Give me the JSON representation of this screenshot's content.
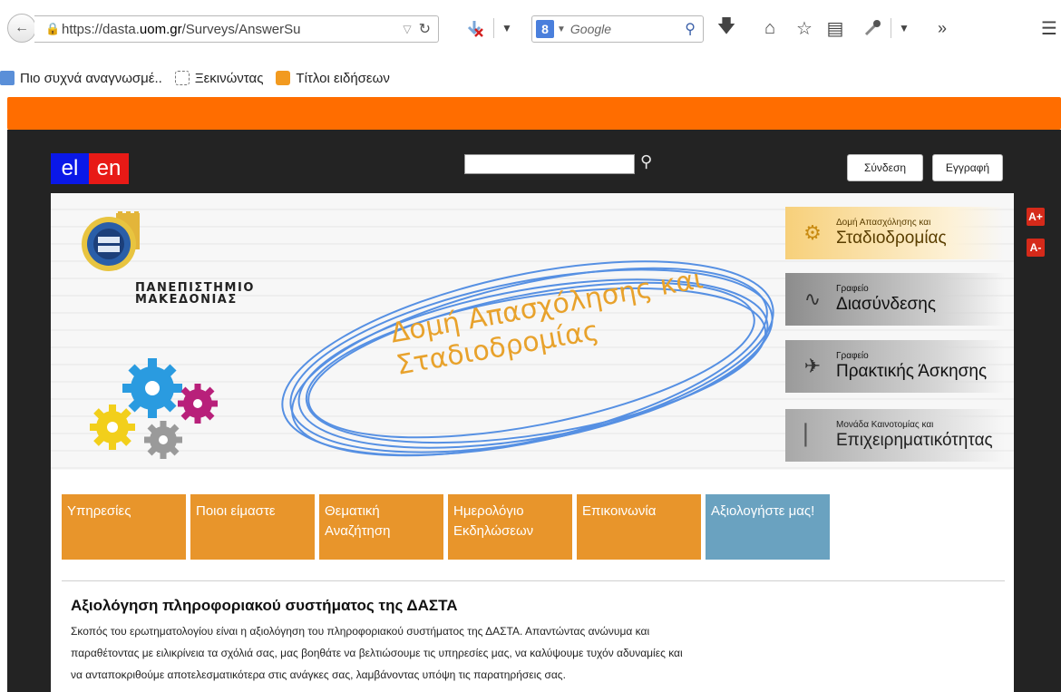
{
  "browser": {
    "url_prefix": "https://dasta.",
    "url_domain": "uom.gr",
    "url_path": "/Surveys/AnswerSu",
    "search_engine_badge": "8",
    "search_placeholder": "Google",
    "bookmarks": [
      {
        "label": "Πιο συχνά αναγνωσμέ..",
        "icon": "bookmark-page-icon"
      },
      {
        "label": "Ξεκινώντας",
        "icon": "dashed-page-icon"
      },
      {
        "label": "Τίτλοι ειδήσεων",
        "icon": "rss-icon"
      }
    ],
    "accent": "#ff6d00"
  },
  "header": {
    "lang_el": "el",
    "lang_en": "en",
    "login": "Σύνδεση",
    "register": "Εγγραφή",
    "font_increase": "A+",
    "font_decrease": "A-"
  },
  "banner": {
    "university_line1": "ΠΑΝΕΠΙΣΤΗΜΙΟ",
    "university_line2": "ΜΑΚΕΔΟΝΙΑΣ",
    "slogan_line1": "Δομή Απασχόλησης και",
    "slogan_line2": "Σταδιοδρομίας",
    "links": [
      {
        "small": "Δομή Απασχόλησης και",
        "big": "Σταδιοδρομίας"
      },
      {
        "small": "Γραφείο",
        "big": "Διασύνδεσης"
      },
      {
        "small": "Γραφείο",
        "big": "Πρακτικής Άσκησης"
      },
      {
        "small": "Μονάδα Καινοτομίας και",
        "big": "Επιχειρηματικότητας"
      }
    ]
  },
  "nav": [
    {
      "label": "Υπηρεσίες"
    },
    {
      "label": "Ποιοι είμαστε"
    },
    {
      "label": "Θεματική Αναζήτηση"
    },
    {
      "label": "Ημερολόγιο Εκδηλώσεων"
    },
    {
      "label": "Επικοινωνία"
    },
    {
      "label": "Αξιολογήστε μας!"
    }
  ],
  "article": {
    "title": "Αξιολόγηση πληροφοριακού συστήματος της ΔΑΣΤΑ",
    "line1": "Σκοπός του ερωτηματολογίου είναι η αξιολόγηση του πληροφοριακού συστήματος της ΔΑΣΤΑ. Απαντώντας ανώνυμα και",
    "line2": "παραθέτοντας με ειλικρίνεια τα σχόλιά σας, μας βοηθάτε να βελτιώσουμε τις υπηρεσίες μας, να καλύψουμε τυχόν αδυναμίες και",
    "line3": "να ανταποκριθούμε αποτελεσματικότερα στις ανάγκες σας, λαμβάνοντας υπόψη τις παρατηρήσεις σας."
  }
}
